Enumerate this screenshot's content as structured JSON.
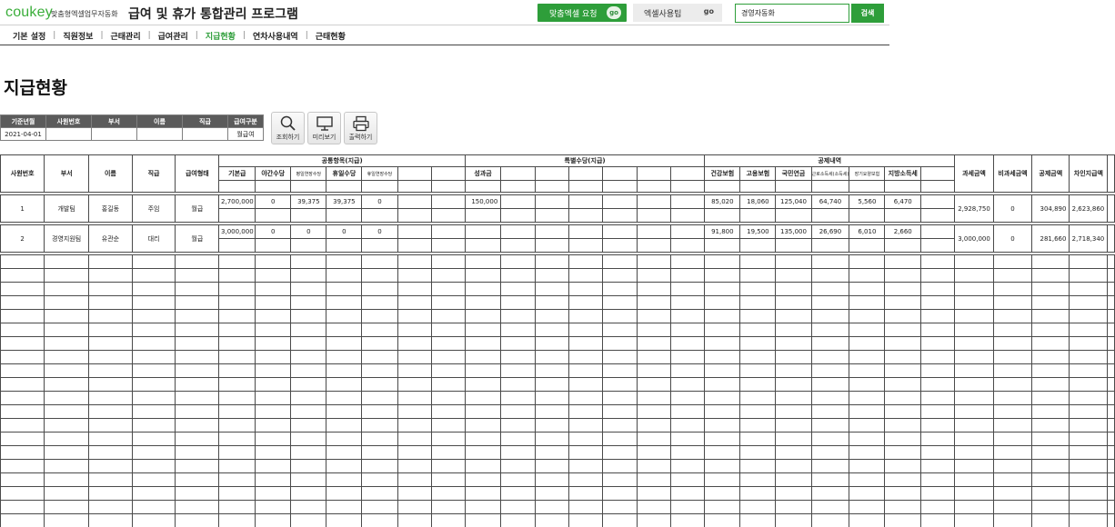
{
  "brand": {
    "logo": "coukey",
    "tagline": "맞춤형엑셀업무자동화"
  },
  "app_title": "급여 및 휴가 통합관리 프로그램",
  "top_actions": {
    "request_label": "맞춤엑셀 요청",
    "request_go": "go",
    "tips_label": "엑셀사용팁",
    "tips_go": "go",
    "search_value": "경영자동화",
    "search_button": "검색"
  },
  "menu": [
    "기본 설정",
    "직원정보",
    "근태관리",
    "급여관리",
    "지급현황",
    "연차사용내역",
    "근태현황"
  ],
  "active_menu": "지급현황",
  "page_title": "지급현황",
  "filter": {
    "headers": [
      "기준년월",
      "사원번호",
      "부서",
      "이름",
      "직급",
      "급여구분"
    ],
    "values": [
      "2021-04-01",
      "",
      "",
      "",
      "",
      "월급여"
    ]
  },
  "tools": {
    "inquire": "조회하기",
    "preview": "미리보기",
    "print": "출력하기"
  },
  "table": {
    "base_headers": [
      "사원번호",
      "부서",
      "이름",
      "직급",
      "급여형태"
    ],
    "group_fixed": "공통항목(지급)",
    "fixed_cols": [
      "기본급",
      "야간수당",
      "평일연장수당",
      "휴일수당",
      "휴일연장수당",
      "",
      ""
    ],
    "group_special": "특별수당(지급)",
    "special_cols": [
      "성과금",
      "",
      "",
      "",
      "",
      "",
      ""
    ],
    "group_deduct": "공제내역",
    "deduct_cols": [
      "건강보험",
      "고용보험",
      "국민연금",
      "근로소득세(소득세)",
      "장기요양보험",
      "지방소득세",
      ""
    ],
    "summary_cols": [
      "과세금액",
      "비과세금액",
      "공제금액",
      "차인지급액"
    ],
    "rows": [
      {
        "base": [
          "1",
          "개발팀",
          "홍길동",
          "주임",
          "월급"
        ],
        "fixed": [
          "2,700,000",
          "0",
          "39,375",
          "39,375",
          "0",
          "",
          ""
        ],
        "special": [
          "150,000",
          "",
          "",
          "",
          "",
          "",
          ""
        ],
        "deduct": [
          "85,020",
          "18,060",
          "125,040",
          "64,740",
          "5,560",
          "6,470",
          ""
        ],
        "summary": [
          "2,928,750",
          "0",
          "304,890",
          "2,623,860"
        ]
      },
      {
        "base": [
          "2",
          "경영지원팀",
          "유관순",
          "대리",
          "월급"
        ],
        "fixed": [
          "3,000,000",
          "0",
          "0",
          "0",
          "0",
          "",
          ""
        ],
        "special": [
          "",
          "",
          "",
          "",
          "",
          "",
          ""
        ],
        "deduct": [
          "91,800",
          "19,500",
          "135,000",
          "26,690",
          "6,010",
          "2,660",
          ""
        ],
        "summary": [
          "3,000,000",
          "0",
          "281,660",
          "2,718,340"
        ]
      }
    ]
  }
}
